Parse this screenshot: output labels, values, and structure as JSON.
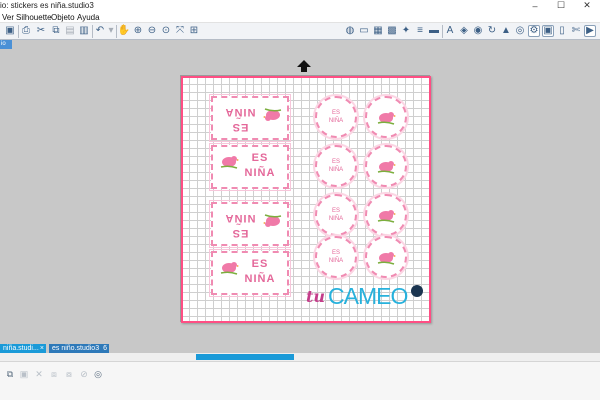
{
  "window": {
    "title": "io: stickers es niña.studio3",
    "controls": [
      "–",
      "☐",
      "✕"
    ]
  },
  "menu": [
    "Ver",
    "Silhouette",
    "Objeto",
    "Ayuda"
  ],
  "sidebar_tab": {
    "label": "io"
  },
  "stickers": {
    "rect_label_top": "ES",
    "rect_label_bottom": "NIÑA",
    "circle_label_top": "ES",
    "circle_label_bottom": "NIÑA"
  },
  "logo": {
    "prefix": "tu",
    "name": "CAMEO"
  },
  "tabs": [
    {
      "label": "niña.studi...",
      "close": "×",
      "color": "#1a9ad8"
    },
    {
      "label": "es niño.studio3",
      "close": "6",
      "color": "#2e79b9"
    }
  ],
  "colors": {
    "accent": "#1a9ad8",
    "cut_line": "#ff4e84",
    "sticker_pink": "#e4689a",
    "bird_pink": "#f07aa8"
  }
}
